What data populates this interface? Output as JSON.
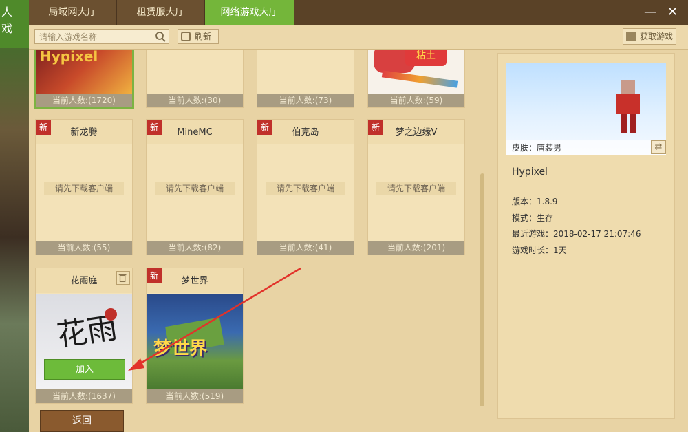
{
  "corner": {
    "line1": "人",
    "line2": "戏"
  },
  "tabs": [
    {
      "label": "局域网大厅"
    },
    {
      "label": "租赁服大厅"
    },
    {
      "label": "网络游戏大厅"
    }
  ],
  "window_controls": {
    "minimize": "—",
    "close": "✕"
  },
  "toolbar": {
    "search_placeholder": "请输入游戏名称",
    "refresh_label": "刷新",
    "get_game_label": "获取游戏"
  },
  "cards_row1": [
    {
      "count": "当前人数:(1720)",
      "art_text": "Hypixel"
    },
    {
      "count": "当前人数:(30)"
    },
    {
      "count": "当前人数:(73)"
    },
    {
      "count": "当前人数:(59)",
      "art_text": "粘土"
    }
  ],
  "cards_row2": [
    {
      "badge": "新",
      "title": "新龙腾",
      "download": "请先下载客户端",
      "count": "当前人数:(55)"
    },
    {
      "badge": "新",
      "title": "MineMC",
      "download": "请先下载客户端",
      "count": "当前人数:(82)"
    },
    {
      "badge": "新",
      "title": "伯克岛",
      "download": "请先下载客户端",
      "count": "当前人数:(41)"
    },
    {
      "badge": "新",
      "title": "梦之边缘V",
      "download": "请先下载客户端",
      "count": "当前人数:(201)"
    }
  ],
  "cards_row3": [
    {
      "title": "花雨庭",
      "count": "当前人数:(1637)",
      "join": "加入",
      "art_text": "花雨"
    },
    {
      "badge": "新",
      "title": "梦世界",
      "count": "当前人数:(519)",
      "art_text": "梦世界"
    }
  ],
  "detail": {
    "skin": "皮肤：唐装男",
    "swap": "⇄",
    "name": "Hypixel",
    "version": "版本：1.8.9",
    "mode": "模式：生存",
    "recent": "最近游戏：2018-02-17 21:07:46",
    "duration": "游戏时长：1天"
  },
  "back_label": "返回",
  "colors": {
    "active_tab": "#74b63a",
    "new_badge": "#c0302a",
    "join_button": "#6dbb3a"
  }
}
